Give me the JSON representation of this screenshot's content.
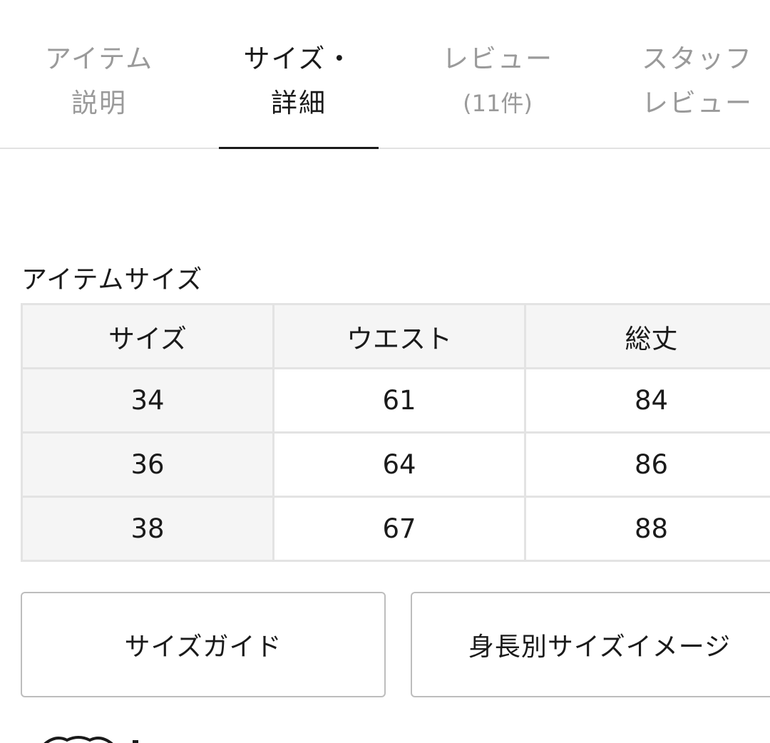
{
  "tabs": [
    {
      "line1": "アイテム",
      "line2": "説明"
    },
    {
      "line1": "サイズ・",
      "line2": "詳細"
    },
    {
      "line1": "レビュー",
      "line2": "(11件)"
    },
    {
      "line1": "スタッフ",
      "line2": "レビュー"
    }
  ],
  "active_tab": 1,
  "section": {
    "title": "アイテムサイズ"
  },
  "size_table": {
    "headers": [
      "サイズ",
      "ウエスト",
      "総丈"
    ],
    "rows": [
      [
        "34",
        "61",
        "84"
      ],
      [
        "36",
        "64",
        "86"
      ],
      [
        "38",
        "67",
        "88"
      ]
    ]
  },
  "buttons": {
    "size_guide": "サイズガイド",
    "height_image": "身長別サイズイメージ"
  },
  "colors": {
    "text": "#1a1a1a",
    "inactive_tab": "#9a9a9a",
    "table_header_bg": "#f5f5f5",
    "border": "#e3e3e3"
  }
}
